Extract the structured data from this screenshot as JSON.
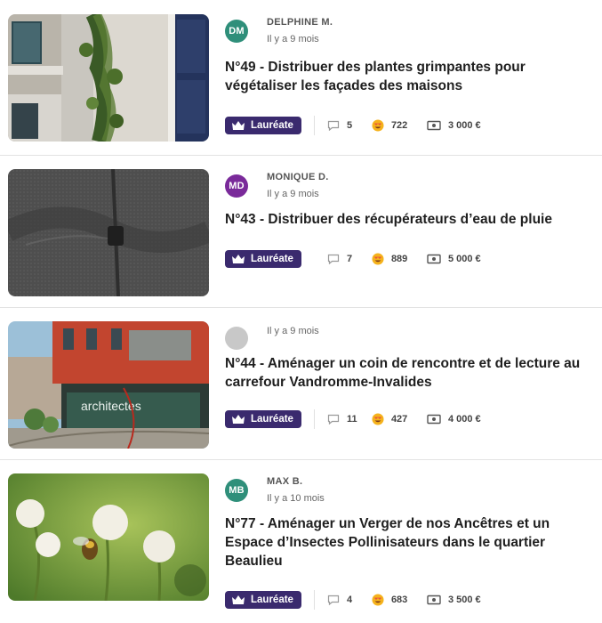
{
  "projects": [
    {
      "author": "DELPHINE M.",
      "initials": "DM",
      "avatar_color": "#2f8f7a",
      "date": "Il y a 9 mois",
      "title": "N°49 - Distribuer des plantes grimpantes pour végétaliser les façades des maisons",
      "badge": "Lauréate",
      "comments": "5",
      "likes": "722",
      "budget": "3 000 €",
      "image_icon": "facade-climbing-plant-photo"
    },
    {
      "author": "MONIQUE D.",
      "initials": "MD",
      "avatar_color": "#7a2a9a",
      "date": "Il y a 9 mois",
      "title": "N°43 - Distribuer des récupérateurs d’eau de pluie",
      "badge": "Lauréate",
      "comments": "7",
      "likes": "889",
      "budget": "5 000 €",
      "image_icon": "rain-barrel-lid-photo"
    },
    {
      "author": "",
      "initials": "",
      "avatar_color": "#c8c8c8",
      "date": "Il y a 9 mois",
      "title": "N°44 - Aménager un coin de rencontre et de lecture au carrefour Vandromme-Invalides",
      "badge": "Lauréate",
      "comments": "11",
      "likes": "427",
      "budget": "4 000 €",
      "image_icon": "street-corner-building-photo",
      "image_text": "architectes"
    },
    {
      "author": "MAX B.",
      "initials": "MB",
      "avatar_color": "#2f8f7a",
      "date": "Il y a 10 mois",
      "title": "N°77 - Aménager un Verger de nos Ancêtres et un Espace d’Insectes Pollinisateurs dans le quartier Beaulieu",
      "badge": "Lauréate",
      "comments": "4",
      "likes": "683",
      "budget": "3 500 €",
      "image_icon": "clover-flowers-bee-photo"
    }
  ],
  "colors": {
    "badge_bg": "#3a2a6e",
    "like_icon": "#e8573a",
    "divider": "#e3e3e3"
  }
}
